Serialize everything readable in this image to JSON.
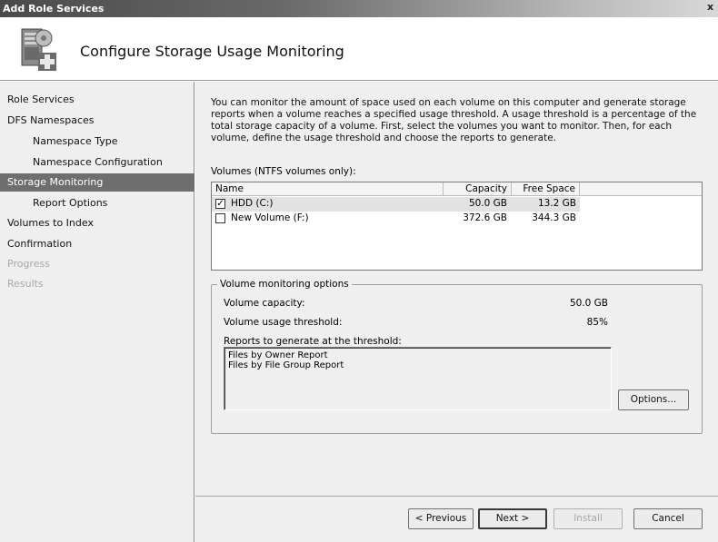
{
  "window": {
    "title": "Add Role Services",
    "close_glyph": "x"
  },
  "header": {
    "title": "Configure Storage Usage Monitoring",
    "icon": "server-storage-icon"
  },
  "nav": {
    "items": [
      {
        "label": "Role Services",
        "state": "normal"
      },
      {
        "label": "DFS Namespaces",
        "state": "normal"
      },
      {
        "label": "Namespace Type",
        "state": "normal"
      },
      {
        "label": "Namespace Configuration",
        "state": "normal"
      },
      {
        "label": "Storage Monitoring",
        "state": "active"
      },
      {
        "label": "Report Options",
        "state": "normal"
      },
      {
        "label": "Volumes to Index",
        "state": "normal"
      },
      {
        "label": "Confirmation",
        "state": "normal"
      },
      {
        "label": "Progress",
        "state": "disabled"
      },
      {
        "label": "Results",
        "state": "disabled"
      }
    ]
  },
  "main": {
    "description": "You can monitor the amount of space used on each volume on this computer and generate storage reports when a volume reaches a specified usage threshold.  A usage threshold is a percentage of the total storage capacity of a volume. First, select the volumes you want to monitor.  Then, for each volume, define the usage threshold and choose the reports to generate.",
    "volumes_label": "Volumes (NTFS volumes only):",
    "columns": [
      "Name",
      "Capacity",
      "Free Space"
    ],
    "volumes": [
      {
        "name": "HDD (C:)",
        "capacity": "50.0 GB",
        "free": "13.2 GB",
        "checked": true,
        "selected": true,
        "check_glyph": "✓"
      },
      {
        "name": "New Volume (F:)",
        "capacity": "372.6 GB",
        "free": "344.3 GB",
        "checked": false,
        "selected": false,
        "check_glyph": ""
      }
    ],
    "options_group": {
      "legend": "Volume monitoring options",
      "capacity_label": "Volume capacity:",
      "capacity_value": "50.0 GB",
      "threshold_label": "Volume usage threshold:",
      "threshold_value": "85%",
      "reports_label": "Reports to generate at the threshold:",
      "reports": [
        "Files by Owner Report",
        "Files by File Group Report"
      ],
      "options_button": "Options..."
    }
  },
  "footer": {
    "previous": "< Previous",
    "next": "Next >",
    "install": "Install",
    "cancel": "Cancel"
  }
}
